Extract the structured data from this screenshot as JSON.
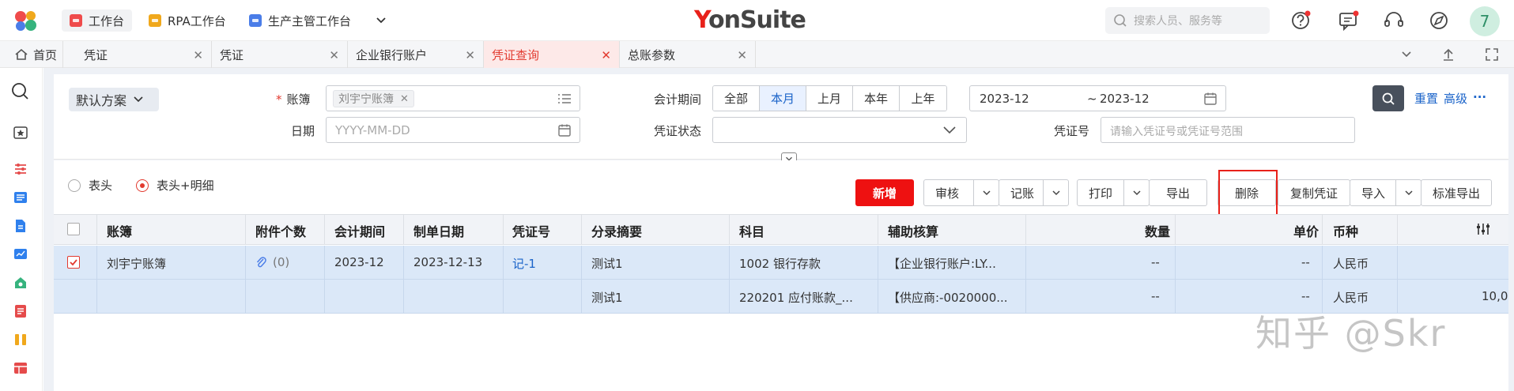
{
  "topbar": {
    "workbench_tabs": [
      {
        "label": "工作台",
        "color": "#ef4b4b"
      },
      {
        "label": "RPA工作台",
        "color": "#f0a81c"
      },
      {
        "label": "生产主管工作台",
        "color": "#4a7de8"
      }
    ],
    "brand_prefix": "Y",
    "brand_rest": "onSuite",
    "search_placeholder": "搜索人员、服务等",
    "avatar_text": "7"
  },
  "tabs": [
    {
      "label": "首页",
      "icon": "home-icon"
    },
    {
      "label": "凭证"
    },
    {
      "label": "凭证"
    },
    {
      "label": "企业银行账户"
    },
    {
      "label": "凭证查询",
      "active": true
    },
    {
      "label": "总账参数"
    }
  ],
  "filter": {
    "scheme_label": "默认方案",
    "ledger_label": "账簿",
    "ledger_value": "刘宇宁账簿",
    "date_label": "日期",
    "date_placeholder": "YYYY-MM-DD",
    "period_label": "会计期间",
    "period_options": [
      "全部",
      "本月",
      "上月",
      "本年",
      "上年"
    ],
    "period_selected": "本月",
    "period_from": "2023-12",
    "period_sep": "~",
    "period_to": "2023-12",
    "status_label": "凭证状态",
    "voucher_no_label": "凭证号",
    "voucher_no_placeholder": "请输入凭证号或凭证号范围",
    "reset_label": "重置",
    "advanced_label": "高级",
    "more_label": "···"
  },
  "toolbar": {
    "radio_header": "表头",
    "radio_header_detail": "表头+明细",
    "radio_selected": "表头+明细",
    "new_label": "新增",
    "audit_label": "审核",
    "post_label": "记账",
    "print_label": "打印",
    "export_label": "导出",
    "delete_label": "删除",
    "copy_label": "复制凭证",
    "import_label": "导入",
    "std_export_label": "标准导出"
  },
  "table": {
    "headers": {
      "ledger": "账簿",
      "attachments": "附件个数",
      "period": "会计期间",
      "made_date": "制单日期",
      "voucher_no": "凭证号",
      "summary": "分录摘要",
      "subject": "科目",
      "aux": "辅助核算",
      "qty": "数量",
      "price": "单价",
      "currency": "币种"
    },
    "row": {
      "ledger": "刘宇宁账簿",
      "attachments": "(0)",
      "period": "2023-12",
      "made_date": "2023-12-13",
      "voucher_no": "记-1"
    },
    "entries": [
      {
        "summary": "测试1",
        "subject": "1002 银行存款",
        "aux": "【企业银行账户:LY...",
        "qty": "--",
        "price": "--",
        "currency": "人民币",
        "amount": ""
      },
      {
        "summary": "测试1",
        "subject": "220201 应付账款_...",
        "aux": "【供应商:-0020000...",
        "qty": "--",
        "price": "--",
        "currency": "人民币",
        "amount": "10,0"
      }
    ]
  },
  "watermark": "知乎 @Skr"
}
